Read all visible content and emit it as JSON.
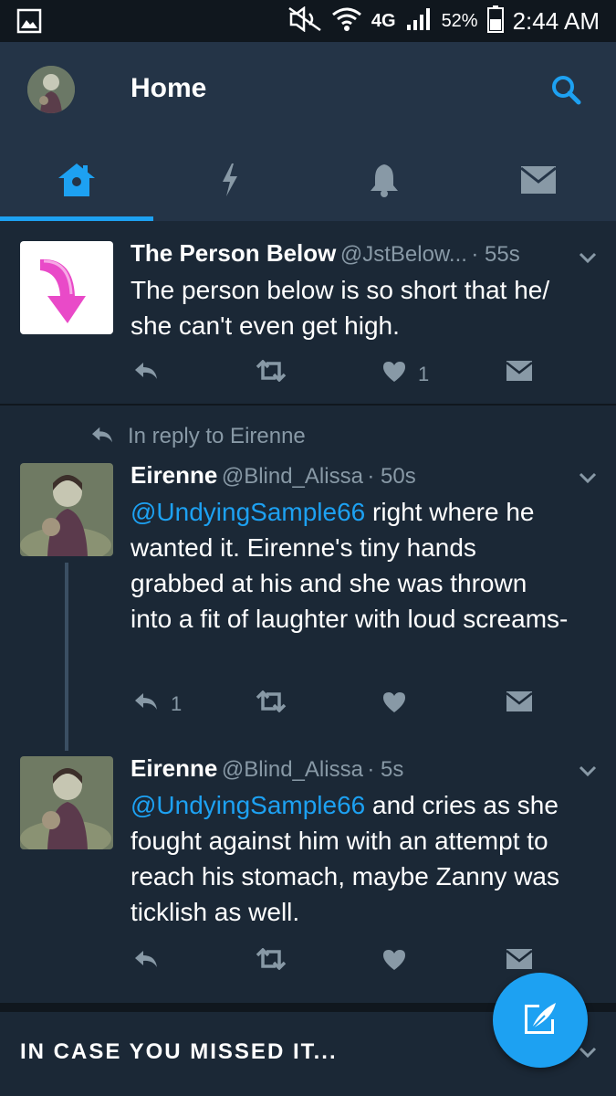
{
  "status_bar": {
    "network": "4G",
    "battery": "52%",
    "time": "2:44 AM"
  },
  "header": {
    "title": "Home",
    "tabs": [
      {
        "name": "home",
        "active": true
      },
      {
        "name": "moments",
        "active": false
      },
      {
        "name": "notifications",
        "active": false
      },
      {
        "name": "messages",
        "active": false
      }
    ]
  },
  "tweets": [
    {
      "name": "The Person Below",
      "handle": "@JstBelow...",
      "time": "· 55s",
      "text_mention": "",
      "text": "The person below is so short that he/ she can't even get high.",
      "reply_count": "",
      "like_count": "1"
    },
    {
      "reply_context": "In reply to Eirenne",
      "name": "Eirenne",
      "handle": "@Blind_Alissa",
      "time": "· 50s",
      "text_mention": "@UndyingSample66",
      "text": " right where he wanted it. Eirenne's tiny hands grabbed at his and she was thrown into a fit of laughter with loud screams-",
      "reply_count": "1",
      "like_count": ""
    },
    {
      "name": "Eirenne",
      "handle": "@Blind_Alissa",
      "time": "· 5s",
      "text_mention": "@UndyingSample66",
      "text": " and cries as she fought against him with an attempt to reach his stomach, maybe Zanny was ticklish as well.",
      "reply_count": "",
      "like_count": ""
    }
  ],
  "icym": {
    "label": "IN CASE YOU MISSED IT..."
  },
  "colors": {
    "accent": "#1da1f2",
    "background": "#1b2836",
    "header": "#243447",
    "muted": "#8899a6"
  }
}
